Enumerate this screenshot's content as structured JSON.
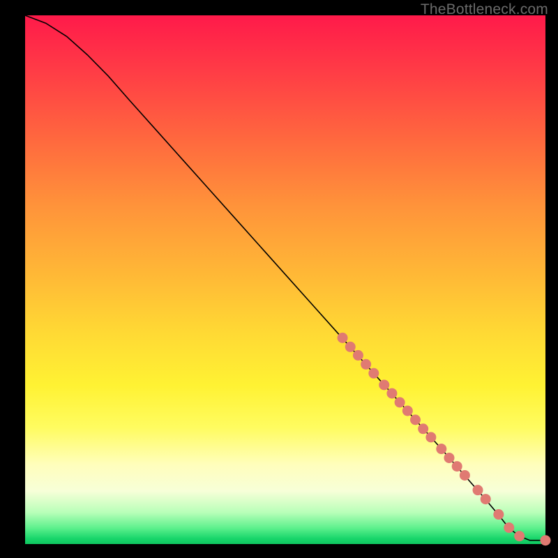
{
  "watermark": "TheBottleneck.com",
  "chart_data": {
    "type": "line",
    "title": "",
    "xlabel": "",
    "ylabel": "",
    "xlim": [
      0,
      100
    ],
    "ylim": [
      0,
      100
    ],
    "curve": {
      "name": "main-curve",
      "points": [
        {
          "x": 0,
          "y": 100.0
        },
        {
          "x": 4,
          "y": 98.5
        },
        {
          "x": 8,
          "y": 96.0
        },
        {
          "x": 12,
          "y": 92.5
        },
        {
          "x": 16,
          "y": 88.5
        },
        {
          "x": 20,
          "y": 84.0
        },
        {
          "x": 25,
          "y": 78.5
        },
        {
          "x": 30,
          "y": 73.0
        },
        {
          "x": 35,
          "y": 67.5
        },
        {
          "x": 40,
          "y": 62.0
        },
        {
          "x": 45,
          "y": 56.5
        },
        {
          "x": 50,
          "y": 51.0
        },
        {
          "x": 55,
          "y": 45.5
        },
        {
          "x": 60,
          "y": 40.0
        },
        {
          "x": 65,
          "y": 34.5
        },
        {
          "x": 70,
          "y": 29.0
        },
        {
          "x": 75,
          "y": 23.5
        },
        {
          "x": 80,
          "y": 18.0
        },
        {
          "x": 84,
          "y": 13.5
        },
        {
          "x": 88,
          "y": 9.0
        },
        {
          "x": 91,
          "y": 5.5
        },
        {
          "x": 93,
          "y": 3.0
        },
        {
          "x": 95,
          "y": 1.5
        },
        {
          "x": 97,
          "y": 0.7
        },
        {
          "x": 100,
          "y": 0.7
        }
      ]
    },
    "dots": {
      "name": "scatter-dots",
      "color": "#e07a72",
      "radius": 7.5,
      "points": [
        {
          "x": 61.0,
          "y": 39.0
        },
        {
          "x": 62.5,
          "y": 37.3
        },
        {
          "x": 64.0,
          "y": 35.7
        },
        {
          "x": 65.5,
          "y": 34.0
        },
        {
          "x": 67.0,
          "y": 32.3
        },
        {
          "x": 69.0,
          "y": 30.1
        },
        {
          "x": 70.5,
          "y": 28.5
        },
        {
          "x": 72.0,
          "y": 26.8
        },
        {
          "x": 73.5,
          "y": 25.2
        },
        {
          "x": 75.0,
          "y": 23.5
        },
        {
          "x": 76.5,
          "y": 21.8
        },
        {
          "x": 78.0,
          "y": 20.2
        },
        {
          "x": 80.0,
          "y": 18.0
        },
        {
          "x": 81.5,
          "y": 16.3
        },
        {
          "x": 83.0,
          "y": 14.7
        },
        {
          "x": 84.5,
          "y": 13.0
        },
        {
          "x": 87.0,
          "y": 10.2
        },
        {
          "x": 88.5,
          "y": 8.5
        },
        {
          "x": 91.0,
          "y": 5.6
        },
        {
          "x": 93.0,
          "y": 3.1
        },
        {
          "x": 95.0,
          "y": 1.5
        },
        {
          "x": 100.0,
          "y": 0.7
        }
      ]
    }
  }
}
